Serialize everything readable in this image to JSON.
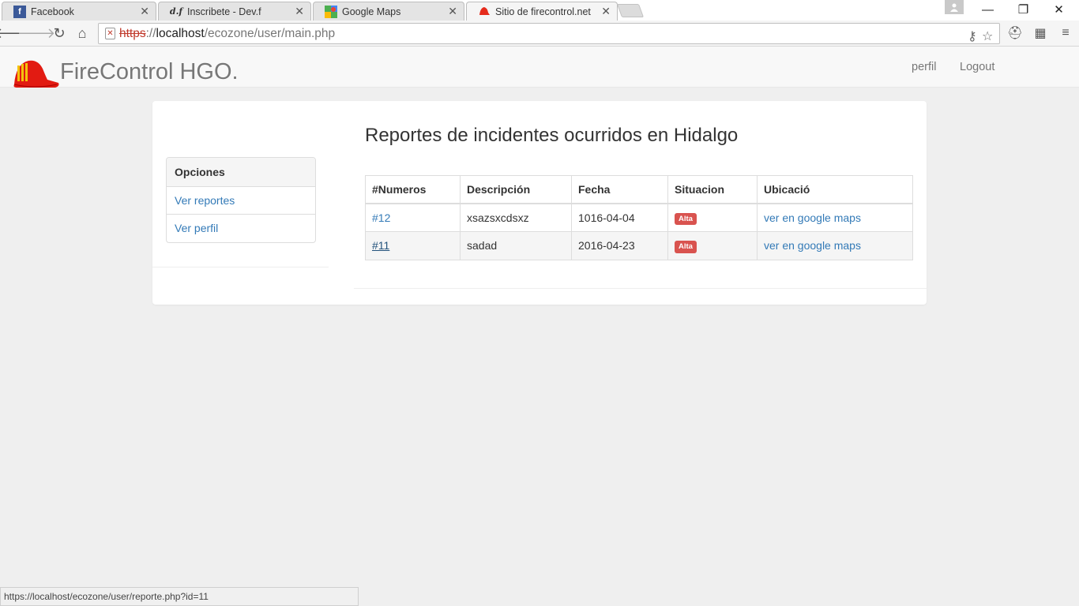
{
  "browser": {
    "tabs": [
      {
        "label": "Facebook",
        "icon": "facebook-icon"
      },
      {
        "label": "Inscribete - Dev.f",
        "icon": "devf-icon"
      },
      {
        "label": "Google Maps",
        "icon": "google-maps-icon"
      },
      {
        "label": "Sitio de firecontrol.net",
        "icon": "fire-helmet-icon"
      }
    ],
    "url": {
      "scheme": "https",
      "separator": "://",
      "host": "localhost",
      "path": "/ecozone/user/main.php"
    },
    "status_url": "https://localhost/ecozone/user/reporte.php?id=11"
  },
  "navbar": {
    "brand": "FireControl HGO.",
    "links": [
      "perfil",
      "Logout"
    ]
  },
  "sidebar": {
    "title": "Opciones",
    "items": [
      "Ver reportes",
      "Ver perfil"
    ]
  },
  "main": {
    "title": "Reportes de incidentes ocurridos en Hidalgo",
    "table": {
      "headers": [
        "#Numeros",
        "Descripción",
        "Fecha",
        "Situacion",
        "Ubicació"
      ],
      "rows": [
        {
          "numero": "#12",
          "descripcion": "xsazsxcdsxz",
          "fecha": "1016-04-04",
          "situacion": "Alta",
          "ubicacion": "ver en google maps"
        },
        {
          "numero": "#11",
          "descripcion": "sadad",
          "fecha": "2016-04-23",
          "situacion": "Alta",
          "ubicacion": "ver en google maps"
        }
      ]
    }
  },
  "colors": {
    "link": "#337ab7",
    "badge_danger": "#d9534f",
    "navbar_bg": "#f8f8f8",
    "page_bg": "#efefef"
  }
}
